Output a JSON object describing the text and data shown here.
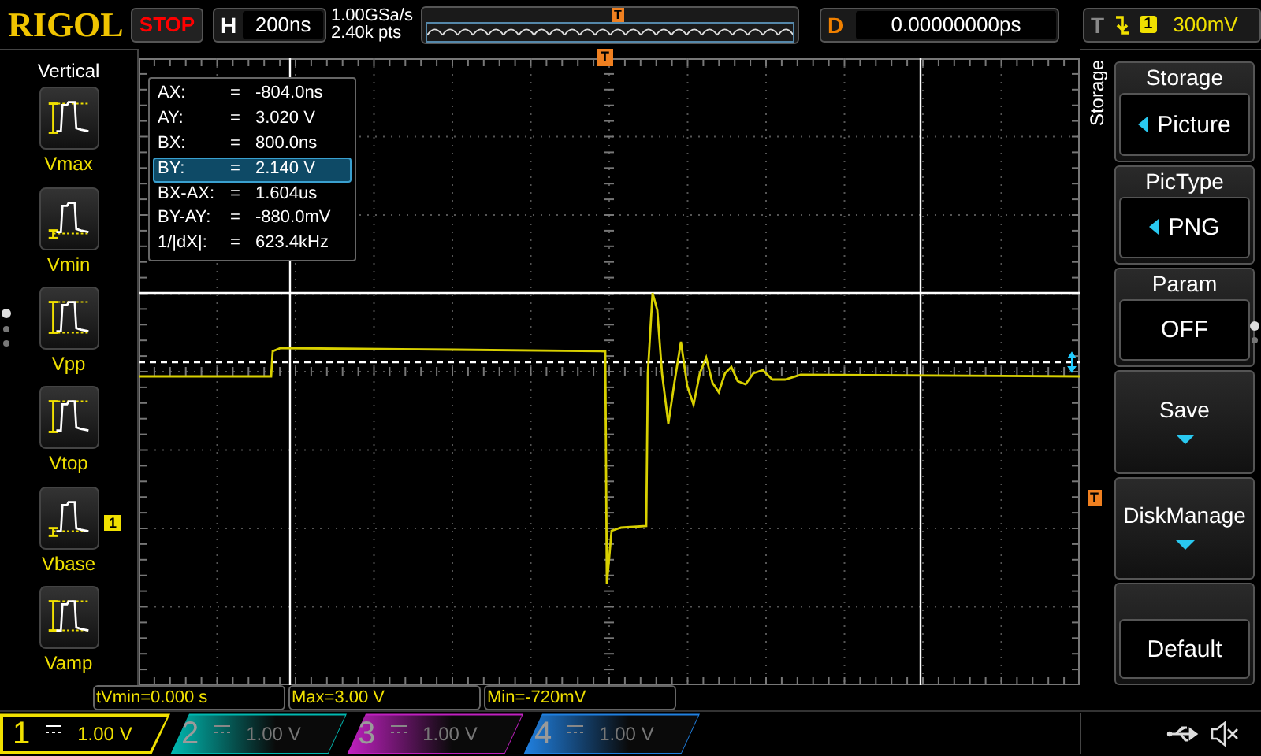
{
  "top_bar": {
    "brand": "RIGOL",
    "run_state": "STOP",
    "horizontal": {
      "label": "H",
      "value": "200ns"
    },
    "sample_rate": "1.00GSa/s",
    "memory_depth": "2.40k pts",
    "overview_marker": "T",
    "delay": {
      "label": "D",
      "value": "0.00000000ps"
    },
    "trigger": {
      "label": "T",
      "source": "1",
      "level": "300mV"
    }
  },
  "sidebar": {
    "title": "Vertical",
    "items": [
      {
        "label": "Vmax",
        "kind": "vmax"
      },
      {
        "label": "Vmin",
        "kind": "vmin"
      },
      {
        "label": "Vpp",
        "kind": "vpp"
      },
      {
        "label": "Vtop",
        "kind": "vtop"
      },
      {
        "label": "Vbase",
        "kind": "vbase"
      },
      {
        "label": "Vamp",
        "kind": "vamp"
      }
    ]
  },
  "plot": {
    "trigger_position_marker": "T",
    "trigger_level_marker": "T",
    "channel_marker": "1"
  },
  "cursor_table": [
    {
      "label": "AX:",
      "equals": "=",
      "value": "-804.0ns",
      "selected": false
    },
    {
      "label": "AY:",
      "equals": "=",
      "value": "3.020 V",
      "selected": false
    },
    {
      "label": "BX:",
      "equals": "=",
      "value": "800.0ns",
      "selected": false
    },
    {
      "label": "BY:",
      "equals": "=",
      "value": "2.140 V",
      "selected": true
    },
    {
      "label": "BX-AX:",
      "equals": "=",
      "value": "1.604us",
      "selected": false
    },
    {
      "label": "BY-AY:",
      "equals": "=",
      "value": "-880.0mV",
      "selected": false
    },
    {
      "label": "1/|dX|:",
      "equals": "=",
      "value": "623.4kHz",
      "selected": false
    }
  ],
  "menu": {
    "title": "Storage",
    "items": [
      {
        "kind": "select",
        "label": "Storage",
        "value": "Picture"
      },
      {
        "kind": "select",
        "label": "PicType",
        "value": "PNG"
      },
      {
        "kind": "value",
        "label": "Param",
        "value": "OFF"
      },
      {
        "kind": "submenu",
        "label": "Save"
      },
      {
        "kind": "submenu",
        "label": "DiskManage"
      },
      {
        "kind": "action",
        "value": "Default"
      }
    ]
  },
  "measurements": [
    "tVmin=0.000 s",
    "Max=3.00 V",
    "Min=-720mV"
  ],
  "channels": [
    {
      "number": "1",
      "scale": "1.00 V",
      "selected": true,
      "color": "#f0e000"
    },
    {
      "number": "2",
      "scale": "1.00 V",
      "selected": false,
      "color": "#00b8b0"
    },
    {
      "number": "3",
      "scale": "1.00 V",
      "selected": false,
      "color": "#c020c0"
    },
    {
      "number": "4",
      "scale": "1.00 V",
      "selected": false,
      "color": "#2080e0"
    }
  ]
}
